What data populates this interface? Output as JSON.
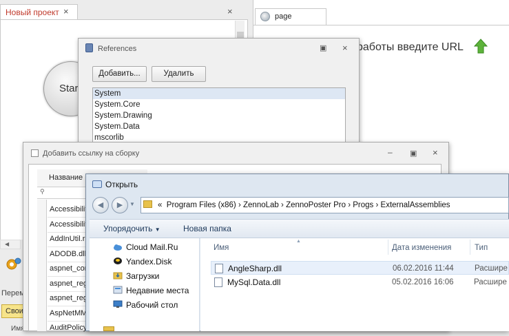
{
  "main": {
    "left_tab_label": "Новый проект",
    "tab_close": "×",
    "start_label": "Star",
    "right_tab_label": "page",
    "url_hint": "работы введите URL",
    "side_label": "Перем",
    "side_tab": "Свои",
    "side_col": "Имя"
  },
  "references": {
    "title": "References",
    "add_button": "Добавить...",
    "remove_button": "Удалить",
    "items": [
      "System",
      "System.Core",
      "System.Drawing",
      "System.Data",
      "mscorlib"
    ]
  },
  "add_reference": {
    "title": "Добавить ссылку на сборку",
    "name_header": "Название",
    "assemblies": [
      "Accessibilit",
      "Accessibilit",
      "AddInUtil.r",
      "ADODB.dll",
      "aspnet_cor",
      "aspnet_reg",
      "aspnet_reg",
      "AspNetMM",
      "AuditPolicy"
    ]
  },
  "open_dialog": {
    "title": "Открыть",
    "path": [
      "Program Files (x86)",
      "ZennoLab",
      "ZennoPoster Pro",
      "Progs",
      "ExternalAssemblies"
    ],
    "path_prefix": "«",
    "path_separator": "›",
    "organize_label": "Упорядочить",
    "new_folder_label": "Новая папка",
    "nav_items": [
      {
        "label": "Cloud Mail.Ru",
        "icon": "cloud-icon"
      },
      {
        "label": "Yandex.Disk",
        "icon": "yandex-disk-icon"
      },
      {
        "label": "Загрузки",
        "icon": "downloads-folder-icon"
      },
      {
        "label": "Недавние места",
        "icon": "recent-places-icon"
      },
      {
        "label": "Рабочий стол",
        "icon": "desktop-icon"
      }
    ],
    "columns": {
      "name": "Имя",
      "date": "Дата изменения",
      "type": "Тип"
    },
    "files": [
      {
        "name": "AngleSharp.dll",
        "date": "06.02.2016 11:44",
        "type": "Расшире"
      },
      {
        "name": "MySql.Data.dll",
        "date": "05.02.2016 16:06",
        "type": "Расшире"
      }
    ]
  },
  "colors": {
    "accent_red": "#c0392b",
    "selection": "#dde7f4",
    "dialog_frame": "#dee7f1"
  }
}
